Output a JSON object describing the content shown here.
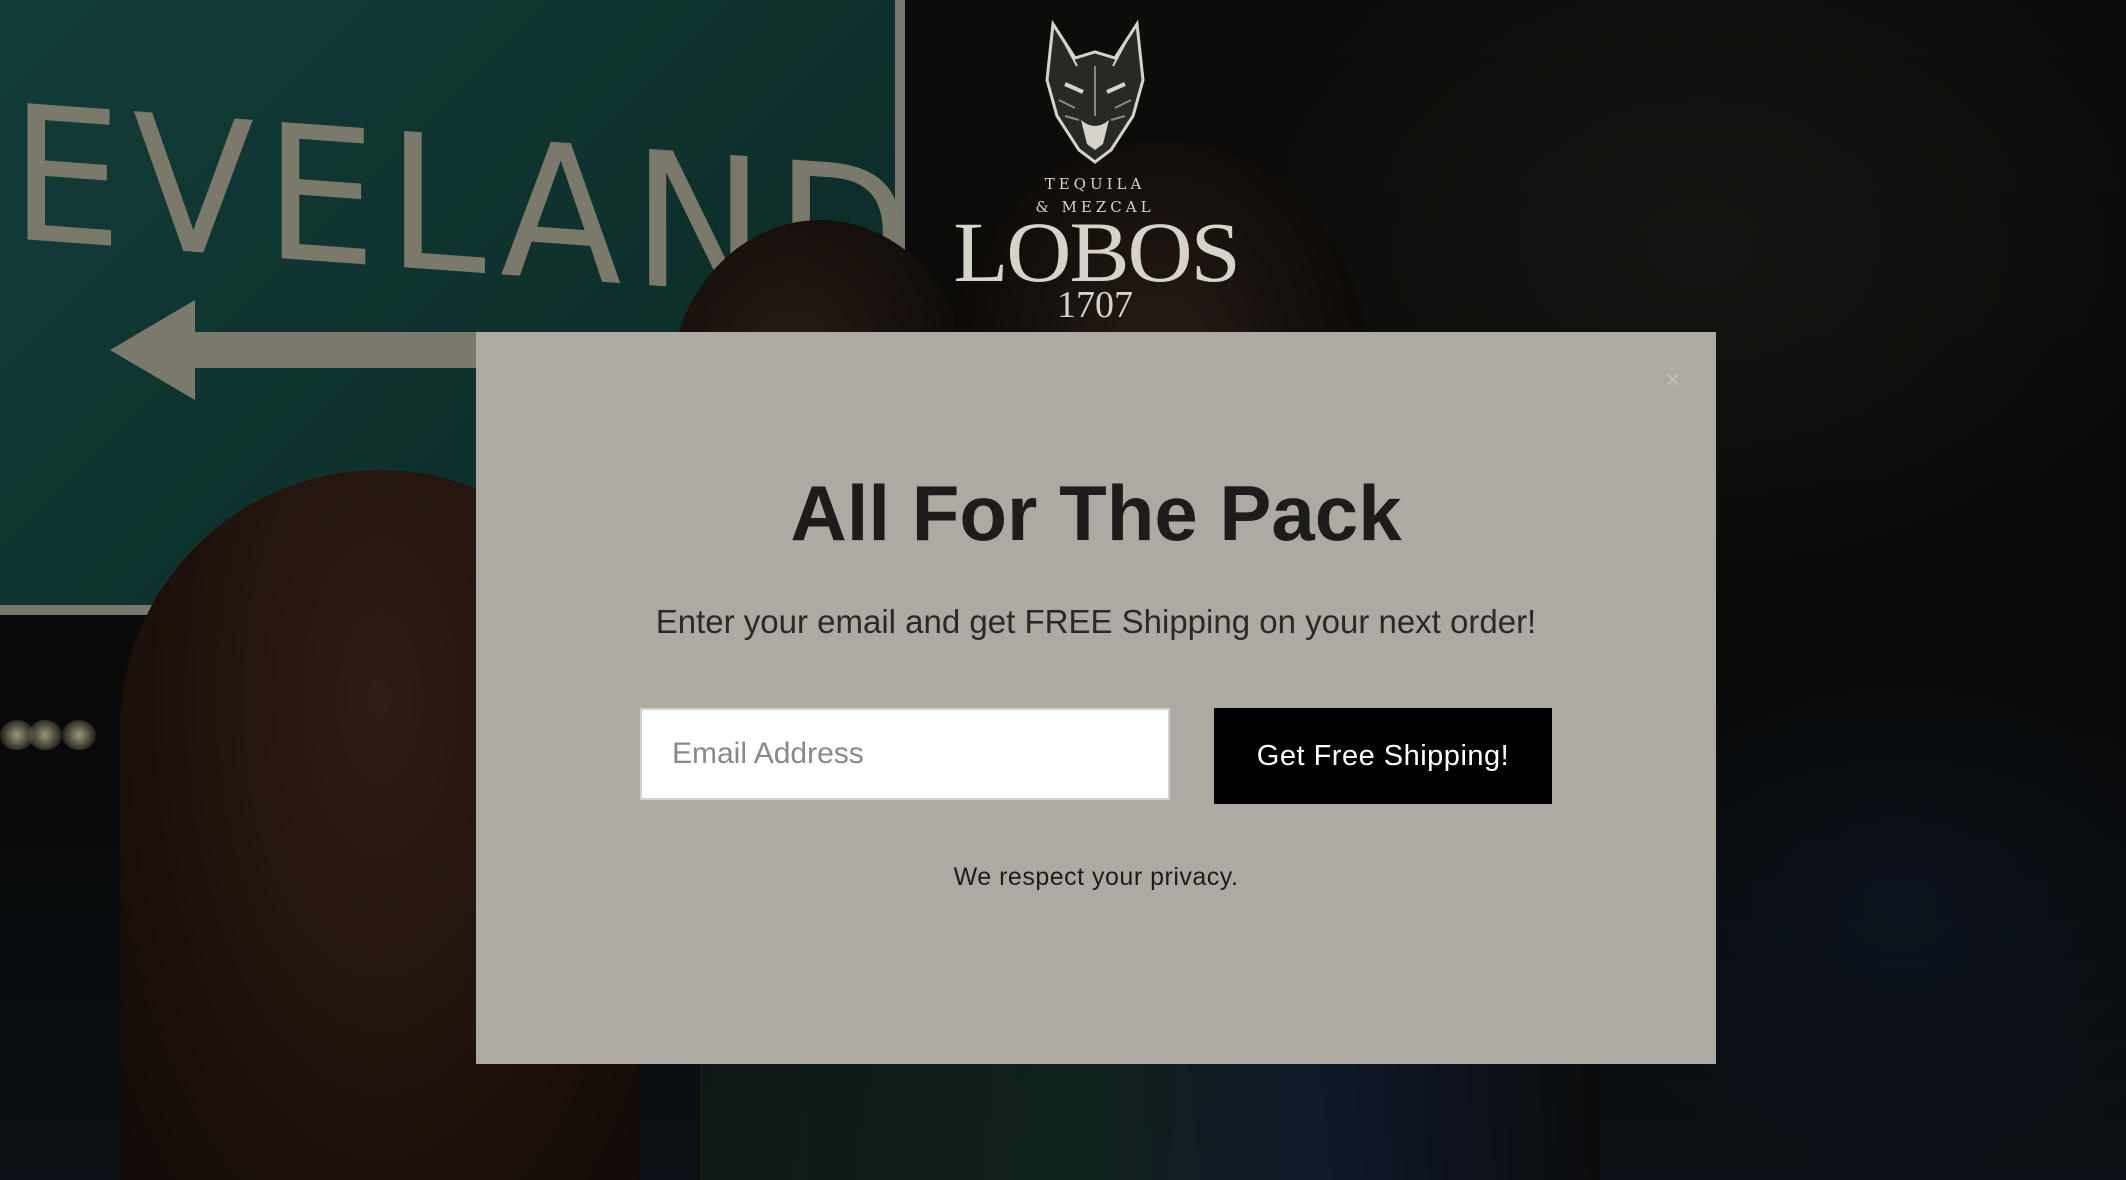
{
  "background": {
    "sign_text": "EVELAND"
  },
  "logo": {
    "subtitle_line1": "TEQUILA",
    "subtitle_line2": "& MEZCAL",
    "name": "LOBOS",
    "year": "1707"
  },
  "modal": {
    "close_symbol": "×",
    "headline": "All For The Pack",
    "subheadline": "Enter your email and get FREE Shipping on your next order!",
    "email_placeholder": "Email Address",
    "email_value": "",
    "submit_label": "Get Free Shipping!",
    "privacy_note": "We respect your privacy.",
    "background_color": "#aea9a2",
    "button_color": "#000000"
  },
  "icons": {
    "logo_icon": "wolf-head-icon",
    "close_icon": "close-icon",
    "background_arrow": "arrow-left-icon"
  }
}
